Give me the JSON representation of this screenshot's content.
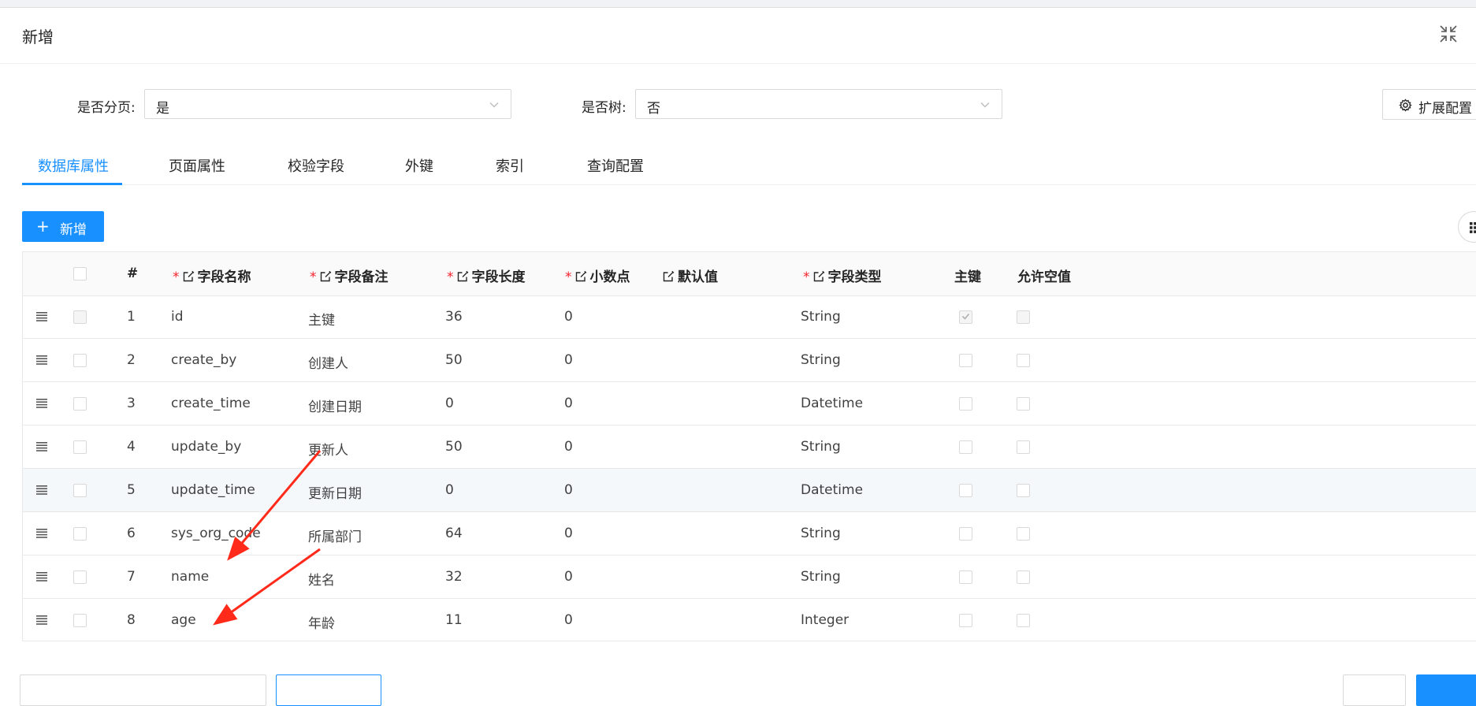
{
  "modal": {
    "title": "新增"
  },
  "form": {
    "paging_label": "是否分页:",
    "paging_value": "是",
    "tree_label": "是否树:",
    "tree_value": "否",
    "ext_config_label": "扩展配置"
  },
  "tabs": [
    {
      "label": "数据库属性",
      "active": true
    },
    {
      "label": "页面属性",
      "active": false
    },
    {
      "label": "校验字段",
      "active": false
    },
    {
      "label": "外键",
      "active": false
    },
    {
      "label": "索引",
      "active": false
    },
    {
      "label": "查询配置",
      "active": false
    }
  ],
  "toolbar": {
    "add_label": "新增",
    "add_icon": "plus-icon",
    "column_setting_icon": "grid-icon"
  },
  "table": {
    "columns": [
      {
        "label": "#",
        "required": false,
        "editable": false
      },
      {
        "label": "字段名称",
        "required": true,
        "editable": true
      },
      {
        "label": "字段备注",
        "required": true,
        "editable": true
      },
      {
        "label": "字段长度",
        "required": true,
        "editable": true
      },
      {
        "label": "小数点",
        "required": true,
        "editable": true
      },
      {
        "label": "默认值",
        "required": false,
        "editable": true
      },
      {
        "label": "字段类型",
        "required": true,
        "editable": true
      },
      {
        "label": "主键",
        "required": false,
        "editable": false
      },
      {
        "label": "允许空值",
        "required": false,
        "editable": false
      }
    ],
    "rows": [
      {
        "index": "1",
        "name": "id",
        "comment": "主键",
        "length": "36",
        "decimal": "0",
        "default": "",
        "type": "String",
        "primary_key": true,
        "nullable": false,
        "locked": true
      },
      {
        "index": "2",
        "name": "create_by",
        "comment": "创建人",
        "length": "50",
        "decimal": "0",
        "default": "",
        "type": "String",
        "primary_key": false,
        "nullable": false,
        "locked": false
      },
      {
        "index": "3",
        "name": "create_time",
        "comment": "创建日期",
        "length": "0",
        "decimal": "0",
        "default": "",
        "type": "Datetime",
        "primary_key": false,
        "nullable": false,
        "locked": false
      },
      {
        "index": "4",
        "name": "update_by",
        "comment": "更新人",
        "length": "50",
        "decimal": "0",
        "default": "",
        "type": "String",
        "primary_key": false,
        "nullable": false,
        "locked": false
      },
      {
        "index": "5",
        "name": "update_time",
        "comment": "更新日期",
        "length": "0",
        "decimal": "0",
        "default": "",
        "type": "Datetime",
        "primary_key": false,
        "nullable": false,
        "locked": false,
        "highlighted": true
      },
      {
        "index": "6",
        "name": "sys_org_code",
        "comment": "所属部门",
        "length": "64",
        "decimal": "0",
        "default": "",
        "type": "String",
        "primary_key": false,
        "nullable": false,
        "locked": false
      },
      {
        "index": "7",
        "name": "name",
        "comment": "姓名",
        "length": "32",
        "decimal": "0",
        "default": "",
        "type": "String",
        "primary_key": false,
        "nullable": false,
        "locked": false
      },
      {
        "index": "8",
        "name": "age",
        "comment": "年龄",
        "length": "11",
        "decimal": "0",
        "default": "",
        "type": "Integer",
        "primary_key": false,
        "nullable": false,
        "locked": false
      }
    ]
  },
  "colors": {
    "primary": "#1890ff",
    "required": "#f5222d",
    "annotation_arrow": "#ff2a1a",
    "row_highlight": "#f5f8fb"
  }
}
